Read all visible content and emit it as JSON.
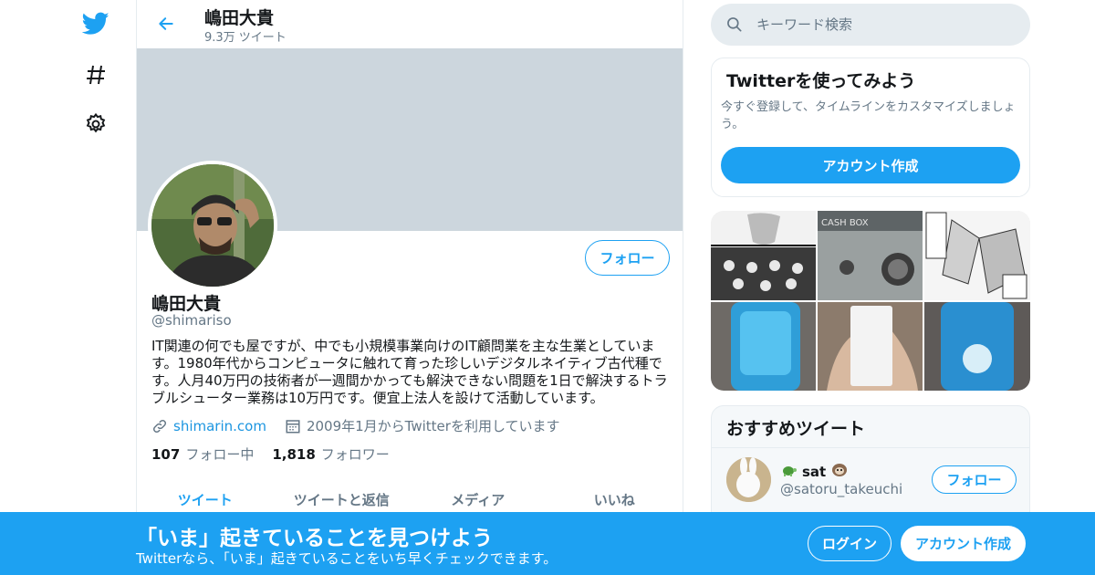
{
  "nav": {
    "items": [
      {
        "icon": "twitter-bird-icon"
      },
      {
        "icon": "hashtag-explore-icon"
      },
      {
        "icon": "gear-icon"
      }
    ]
  },
  "header": {
    "name": "嶋田大貴",
    "tweet_count": "9.3万 ツイート"
  },
  "profile": {
    "name": "嶋田大貴",
    "handle": "@shimariso",
    "follow_label": "フォロー",
    "bio": "IT関連の何でも屋ですが、中でも小規模事業向けのIT顧問業を主な生業としています。1980年代からコンピュータに触れて育った珍しいデジタルネイティブ古代種です。人月40万円の技術者が一週間かかっても解決できない問題を1日で解決するトラブルシューター業務は10万円です。便宜上法人を設けて活動しています。",
    "website": "shimarin.com",
    "joined": "2009年1月からTwitterを利用しています",
    "following_count": "107",
    "following_label": "フォロー中",
    "followers_count": "1,818",
    "followers_label": "フォロワー"
  },
  "tabs": [
    {
      "label": "ツイート",
      "active": true
    },
    {
      "label": "ツイートと返信",
      "active": false
    },
    {
      "label": "メディア",
      "active": false
    },
    {
      "label": "いいね",
      "active": false
    }
  ],
  "search": {
    "placeholder": "キーワード検索"
  },
  "signup_card": {
    "title": "Twitterを使ってみよう",
    "description": "今すぐ登録して、タイムラインをカスタマイズしましょう。",
    "button_label": "アカウント作成"
  },
  "recommended": {
    "title": "おすすめツイート",
    "user": {
      "name": "sat",
      "handle": "@satoru_takeuchi",
      "follow_label": "フォロー"
    }
  },
  "media_grid": {
    "cash_box_label": "CASH BOX"
  },
  "bottom_bar": {
    "title": "「いま」起きていることを見つけよう",
    "subtitle": "Twitterなら、「いま」起きていることをいち早くチェックできます。",
    "login_label": "ログイン",
    "signup_label": "アカウント作成"
  },
  "colors": {
    "accent": "#1da1f2",
    "banner": "#ccd6dd",
    "secondary_text": "#657786"
  }
}
